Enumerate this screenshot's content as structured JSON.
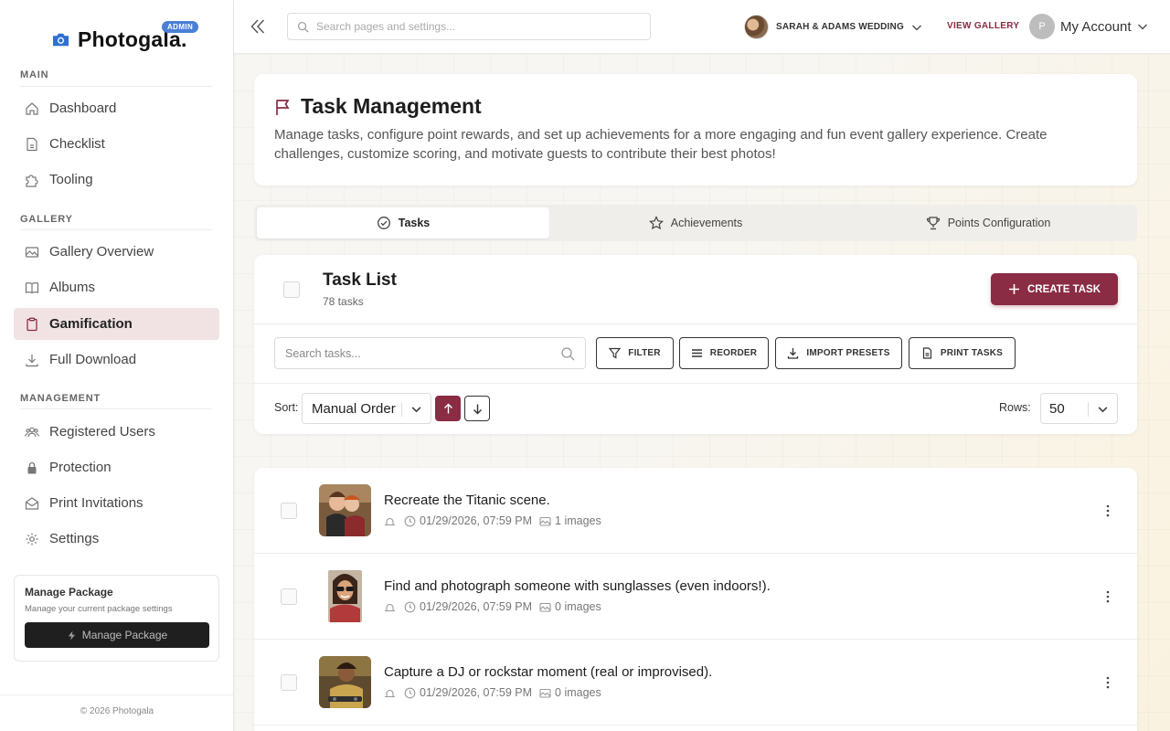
{
  "app": {
    "brand": "Photogala.",
    "badge": "ADMIN",
    "copyright": "© 2026 Photogala"
  },
  "sidebar": {
    "sections": [
      {
        "label": "MAIN"
      },
      {
        "label": "GALLERY"
      },
      {
        "label": "MANAGEMENT"
      }
    ],
    "items": [
      {
        "label": "Dashboard",
        "icon": "home-icon"
      },
      {
        "label": "Checklist",
        "icon": "document-icon"
      },
      {
        "label": "Tooling",
        "icon": "puzzle-icon"
      },
      {
        "label": "Gallery Overview",
        "icon": "image-icon"
      },
      {
        "label": "Albums",
        "icon": "book-icon"
      },
      {
        "label": "Gamification",
        "icon": "clipboard-icon",
        "active": true
      },
      {
        "label": "Full Download",
        "icon": "download-icon"
      },
      {
        "label": "Registered Users",
        "icon": "users-icon"
      },
      {
        "label": "Protection",
        "icon": "lock-icon"
      },
      {
        "label": "Print Invitations",
        "icon": "mail-icon"
      },
      {
        "label": "Settings",
        "icon": "gear-icon"
      }
    ],
    "package": {
      "title": "Manage Package",
      "subtitle": "Manage your current package settings",
      "button": "Manage Package"
    }
  },
  "topbar": {
    "search_placeholder": "Search pages and settings...",
    "gallery_name": "SARAH & ADAMS WEDDING",
    "view_gallery": "VIEW GALLERY",
    "account_initial": "P",
    "account_label": "My Account"
  },
  "header": {
    "title": "Task Management",
    "description": "Manage tasks, configure point rewards, and set up achievements for a more engaging and fun event gallery experience. Create challenges, customize scoring, and motivate guests to contribute their best photos!"
  },
  "tabs": [
    {
      "label": "Tasks",
      "icon": "check-circle-icon",
      "active": true
    },
    {
      "label": "Achievements",
      "icon": "star-icon"
    },
    {
      "label": "Points Configuration",
      "icon": "trophy-icon"
    }
  ],
  "task_list": {
    "title": "Task List",
    "count": "78 tasks",
    "create_button": "CREATE TASK",
    "search_placeholder": "Search tasks...",
    "toolbar": {
      "filter": "FILTER",
      "reorder": "REORDER",
      "import": "IMPORT PRESETS",
      "print": "PRINT TASKS"
    },
    "sort_label": "Sort:",
    "sort_value": "Manual Order",
    "rows_label": "Rows:",
    "rows_value": "50"
  },
  "tasks": [
    {
      "title": "Recreate the Titanic scene.",
      "date": "01/29/2026, 07:59 PM",
      "images": "1 images"
    },
    {
      "title": "Find and photograph someone with sunglasses (even indoors!).",
      "date": "01/29/2026, 07:59 PM",
      "images": "0 images"
    },
    {
      "title": "Capture a DJ or rockstar moment (real or improvised).",
      "date": "01/29/2026, 07:59 PM",
      "images": "0 images"
    }
  ],
  "colors": {
    "accent": "#8a2c44",
    "active_nav_bg": "#f1e2e4",
    "badge": "#4a7fd6"
  }
}
